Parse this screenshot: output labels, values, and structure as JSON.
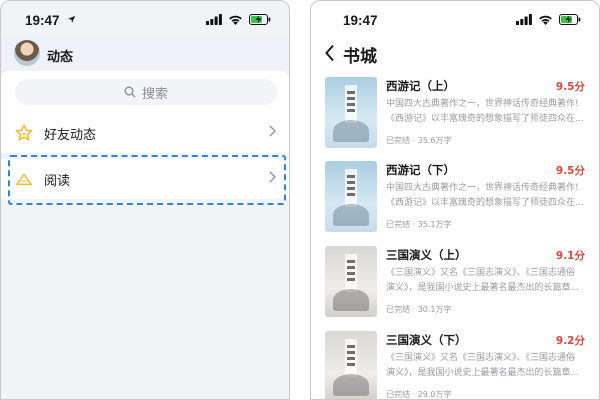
{
  "left": {
    "status_time": "19:47",
    "header_title": "动态",
    "search_placeholder": "搜索",
    "menu": [
      {
        "label": "好友动态"
      },
      {
        "label": "阅读"
      }
    ]
  },
  "right": {
    "status_time": "19:47",
    "title": "书城",
    "books": [
      {
        "title": "西游记（上）",
        "score": "9.5分",
        "desc1": "中国四大古典著作之一，世界神话传奇经典著作!",
        "desc2": "《西游记》以丰富瑰奇的想象描写了师徒四众在...",
        "meta": "已完结 · 35.6万字",
        "cover": "blue"
      },
      {
        "title": "西游记（下）",
        "score": "9.5分",
        "desc1": "中国四大古典著作之一，世界神话传奇经典著作!",
        "desc2": "《西游记》以丰富瑰奇的想象描写了师徒四众在...",
        "meta": "已完结 · 35.1万字",
        "cover": "blue"
      },
      {
        "title": "三国演义（上）",
        "score": "9.1分",
        "desc1": "《三国演义》又名《三国志演义》、《三国志通俗",
        "desc2": "演义》，是我国小说史上最著名最杰出的长篇章...",
        "meta": "已完结 · 30.1万字",
        "cover": "grey"
      },
      {
        "title": "三国演义（下）",
        "score": "9.2分",
        "desc1": "《三国演义》又名《三国志演义》、《三国志通俗",
        "desc2": "演义》，是我国小说史上最著名最杰出的长篇章...",
        "meta": "已完结 · 29.0万字",
        "cover": "grey"
      }
    ]
  },
  "colors": {
    "accent_dashed": "#2f86d6",
    "score_red": "#e0443b",
    "star_yellow": "#f5b92e",
    "battery_green": "#3bc34a"
  }
}
